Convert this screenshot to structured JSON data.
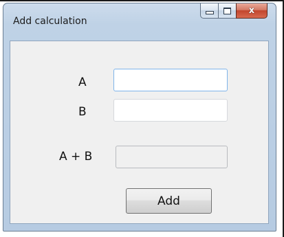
{
  "window": {
    "title": "Add calculation",
    "caption_buttons": {
      "minimize_icon": "minimize-icon",
      "maximize_icon": "maximize-icon",
      "close_icon": "close-icon",
      "close_glyph": "x"
    }
  },
  "form": {
    "label_a": "A",
    "label_b": "B",
    "label_sum": "A + B",
    "value_a": "",
    "value_b": "",
    "value_sum": "",
    "add_label": "Add"
  },
  "colors": {
    "accent_focus": "#7eb4ea",
    "close_red": "#c2452d",
    "frame_blue": "#bfd2e6"
  }
}
